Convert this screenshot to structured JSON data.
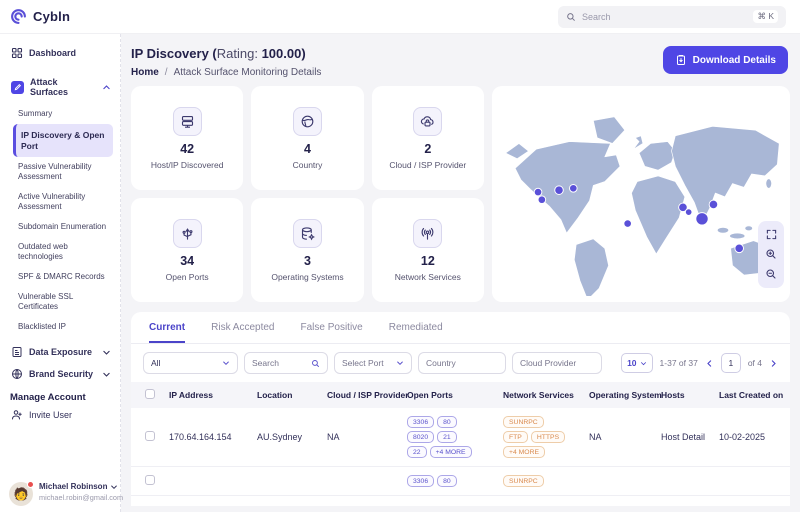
{
  "navbar": {
    "brand": "Cybln",
    "search_placeholder": "Search",
    "shortcut": "⌘ K"
  },
  "sidebar": {
    "dashboard": "Dashboard",
    "attack_surfaces": "Attack Surfaces",
    "sub": [
      "Summary",
      "IP Discovery & Open Port",
      "Passive Vulnerability Assessment",
      "Active Vulnerability Assessment",
      "Subdomain Enumeration",
      "Outdated web technologies",
      "SPF & DMARC Records",
      "Vulnerable SSL Certificates",
      "Blacklisted IP"
    ],
    "data_exposure": "Data Exposure",
    "brand_security": "Brand Security",
    "manage_account": "Manage Account",
    "invite_user": "Invite User",
    "user": {
      "name": "Michael Robinson",
      "email": "michael.robin@gmail.com"
    }
  },
  "header": {
    "title_main": "IP Discovery (",
    "rating_label": "Rating: ",
    "rating_value": "100.00)",
    "breadcrumb_home": "Home",
    "breadcrumb_sep": "/",
    "breadcrumb_current": "Attack Surface Monitoring Details",
    "download_label": "Download Details"
  },
  "stats": [
    {
      "value": "42",
      "label": "Host/IP Discovered",
      "icon": "server-icon"
    },
    {
      "value": "4",
      "label": "Country",
      "icon": "globe-icon"
    },
    {
      "value": "2",
      "label": "Cloud / ISP Provider",
      "icon": "cloud-lock-icon"
    },
    {
      "value": "34",
      "label": "Open Ports",
      "icon": "usb-icon"
    },
    {
      "value": "3",
      "label": "Operating Systems",
      "icon": "database-icon"
    },
    {
      "value": "12",
      "label": "Network Services",
      "icon": "antenna-icon"
    }
  ],
  "tabs": [
    "Current",
    "Risk Accepted",
    "False Positive",
    "Remediated"
  ],
  "filters": {
    "type_selected": "All",
    "search_placeholder": "Search",
    "port_placeholder": "Select Port",
    "country_placeholder": "Country",
    "cloud_placeholder": "Cloud Provider",
    "page_size": "10",
    "range_text": "1-37 of 37",
    "page_number": "1",
    "page_total": "of 4"
  },
  "table": {
    "headers": [
      "IP Address",
      "Location",
      "Cloud / ISP Provider",
      "Open Ports",
      "Network Services",
      "Operating System",
      "Hosts",
      "Last Created on"
    ],
    "rows": [
      {
        "ip": "170.64.164.154",
        "location": "AU.Sydney",
        "cloud": "NA",
        "ports": [
          "3306",
          "80",
          "8020",
          "21",
          "22",
          "+4 MORE"
        ],
        "services": [
          "SUNRPC",
          "FTP",
          "HTTPS",
          "+4 MORE"
        ],
        "os": "NA",
        "hosts": "Host Detail",
        "created": "10-02-2025"
      },
      {
        "ports": [
          "3306",
          "80"
        ],
        "services": [
          "SUNRPC"
        ]
      }
    ]
  },
  "colors": {
    "primary": "#4f46e5",
    "active_bg": "#e6e3fb",
    "port_badge": "#5a52cc",
    "service_badge": "#d98a4e",
    "map_land": "#a9b7d6",
    "map_marker": "#5a50d8"
  }
}
